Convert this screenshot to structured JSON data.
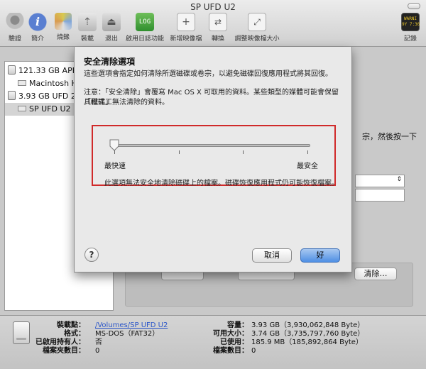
{
  "window": {
    "title": "SP UFD U2"
  },
  "toolbar": {
    "items": [
      {
        "label": "驗證",
        "icon": "microscope-icon"
      },
      {
        "label": "簡介",
        "icon": "info-icon"
      },
      {
        "label": "燒錄",
        "icon": "disc-icon"
      },
      {
        "label": "裝載",
        "icon": "mount-icon"
      },
      {
        "label": "退出",
        "icon": "eject-icon"
      },
      {
        "label": "啟用日誌功能",
        "icon": "journal-icon"
      },
      {
        "label": "新增映像檔",
        "icon": "new-image-icon"
      },
      {
        "label": "轉換",
        "icon": "convert-icon"
      },
      {
        "label": "調整映像檔大小",
        "icon": "resize-image-icon"
      },
      {
        "label": "記錄",
        "icon": "log-icon"
      }
    ],
    "journal_glyph": "LOG",
    "log_glyph": "WARNI\n9Y 7:36"
  },
  "sidebar": {
    "items": [
      {
        "label": "121.33 GB APPLE",
        "type": "disk"
      },
      {
        "label": "Macintosh HD",
        "type": "volume"
      },
      {
        "label": "3.93 GB UFD 2.0",
        "type": "disk"
      },
      {
        "label": "SP UFD U2",
        "type": "volume",
        "selected": true
      }
    ]
  },
  "background": {
    "partial_text_1": "宗，然後按一下",
    "clear_button": "清除…",
    "tabs": [
      "",
      "",
      "",
      ""
    ]
  },
  "dialog": {
    "title": "安全清除選項",
    "intro": "這些選項會指定如何清除所選磁碟或卷宗，以避免磁碟回復應用程式將其回復。",
    "note_line1": "注意：「安全清除」會覆寫 Mac OS X 可取用的資料。某些類型的媒體可能會保留「磁碟工",
    "note_line2": "具程式」無法清除的資料。",
    "slider": {
      "min_label": "最快速",
      "max_label": "最安全",
      "value_fraction": 0.0,
      "ticks": 4
    },
    "slider_description": "此選項無法安全地清除磁碟上的檔案。磁碟恢復應用程式仍可能恢復檔案。",
    "help_label": "?",
    "cancel_label": "取消",
    "ok_label": "好"
  },
  "info": {
    "mount_point_label": "裝載點：",
    "mount_point_value": "/Volumes/SP UFD U2",
    "format_label": "格式：",
    "format_value": "MS-DOS（FAT32）",
    "owners_label": "已啟用持有人：",
    "owners_value": "否",
    "folders_label": "檔案夾數目：",
    "folders_value": "0",
    "capacity_label": "容量：",
    "capacity_value": "3.93 GB（3,930,062,848 Byte）",
    "available_label": "可用大小：",
    "available_value": "3.74 GB（3,735,797,760 Byte）",
    "used_label": "已使用：",
    "used_value": "185.9 MB（185,892,864 Byte）",
    "files_label": "檔案數目：",
    "files_value": "0"
  }
}
